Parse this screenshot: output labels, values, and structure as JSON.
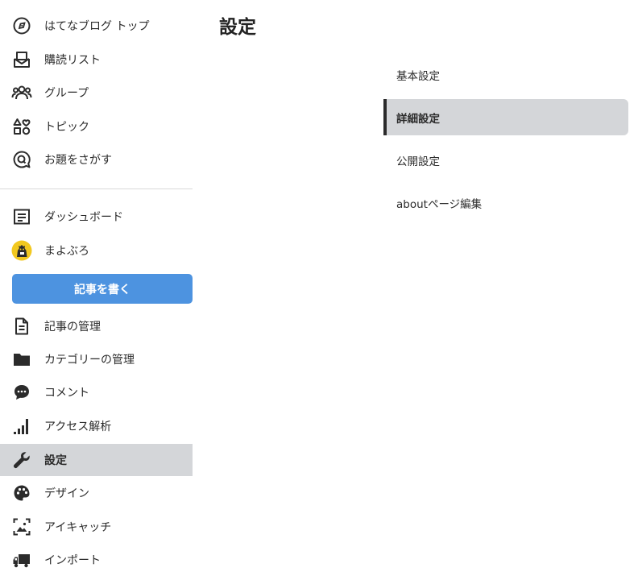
{
  "sidebar": {
    "top_items": [
      {
        "label": "はてなブログ トップ",
        "icon": "compass-icon"
      },
      {
        "label": "購読リスト",
        "icon": "inbox-icon"
      },
      {
        "label": "グループ",
        "icon": "group-icon"
      },
      {
        "label": "トピック",
        "icon": "shapes-icon"
      },
      {
        "label": "お題をさがす",
        "icon": "search-bubble-icon"
      }
    ],
    "dashboard": {
      "label": "ダッシュボード",
      "icon": "dashboard-icon"
    },
    "blog": {
      "label": "まよぶろ",
      "icon": "blog-avatar-icon"
    },
    "write_button": "記事を書く",
    "manage_items": [
      {
        "label": "記事の管理",
        "icon": "document-icon"
      },
      {
        "label": "カテゴリーの管理",
        "icon": "folder-icon"
      },
      {
        "label": "コメント",
        "icon": "comment-icon"
      },
      {
        "label": "アクセス解析",
        "icon": "signal-bars-icon"
      },
      {
        "label": "設定",
        "icon": "wrench-icon",
        "active": true
      },
      {
        "label": "デザイン",
        "icon": "palette-icon"
      },
      {
        "label": "アイキャッチ",
        "icon": "image-frame-icon"
      },
      {
        "label": "インポート",
        "icon": "truck-icon"
      }
    ]
  },
  "main": {
    "title": "設定",
    "settings_menu": [
      {
        "label": "基本設定"
      },
      {
        "label": "詳細設定",
        "active": true
      },
      {
        "label": "公開設定"
      },
      {
        "label": "aboutページ編集"
      }
    ]
  },
  "colors": {
    "accent": "#4d93e0",
    "active_bg": "#d4d6d9",
    "text": "#2b2b2b",
    "avatar_yellow": "#f2c81f"
  }
}
